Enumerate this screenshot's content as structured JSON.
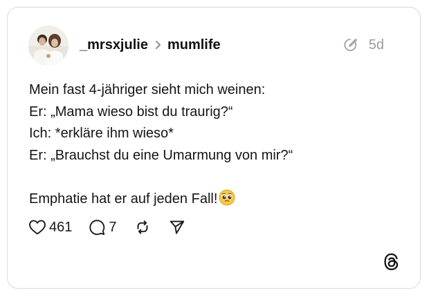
{
  "post": {
    "author": "_mrsxjulie",
    "community": "mumlife",
    "age": "5d",
    "lines": [
      "Mein fast 4-jähriger sieht mich weinen:",
      "Er: „Mama wieso bist du traurig?“",
      "Ich: *erkläre ihm wieso*",
      "Er: „Brauchst du eine Umarmung von mir?“",
      "",
      "Emphatie hat er auf jeden Fall!"
    ],
    "trailing_emoji": "pleading-face-emoji"
  },
  "actions": {
    "likes": "461",
    "replies": "7",
    "repost_icon": "repost-icon",
    "share_icon": "share-icon"
  },
  "icons": {
    "chevron": "chevron-right-icon",
    "timestamp": "edited-clock-icon",
    "brand": "threads-logo-icon"
  },
  "colors": {
    "text": "#101010",
    "muted": "#9a9a9a",
    "border": "#d9d9d9"
  }
}
